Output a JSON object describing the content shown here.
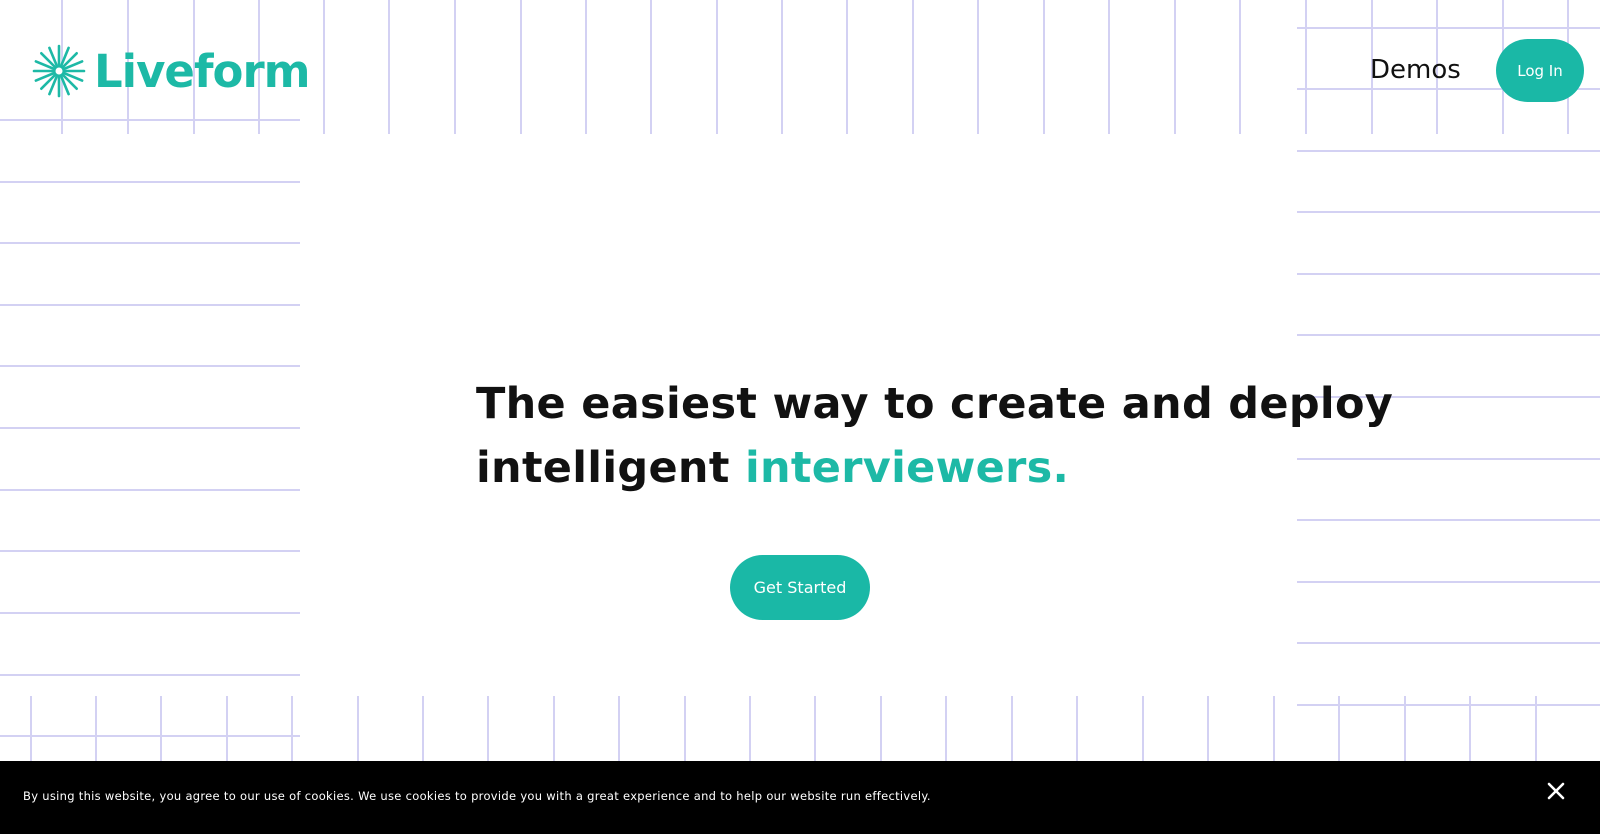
{
  "header": {
    "logo_text": "Liveform",
    "nav_demos": "Demos",
    "login_label": "Log In"
  },
  "hero": {
    "title_line1": "The easiest way to create and deploy",
    "title_line2_prefix": "intelligent ",
    "title_line2_accent": "interviewers.",
    "cta_label": "Get Started"
  },
  "cookie_banner": {
    "text": "By using this website, you agree to our use of cookies. We use cookies to provide you with a great experience and to help our website run effectively.",
    "close_icon": "close-icon"
  },
  "colors": {
    "brand_teal": "#1ab8a6",
    "grid_line": "#d3d1f3",
    "text_dark": "#111111",
    "banner_bg": "#000000"
  }
}
